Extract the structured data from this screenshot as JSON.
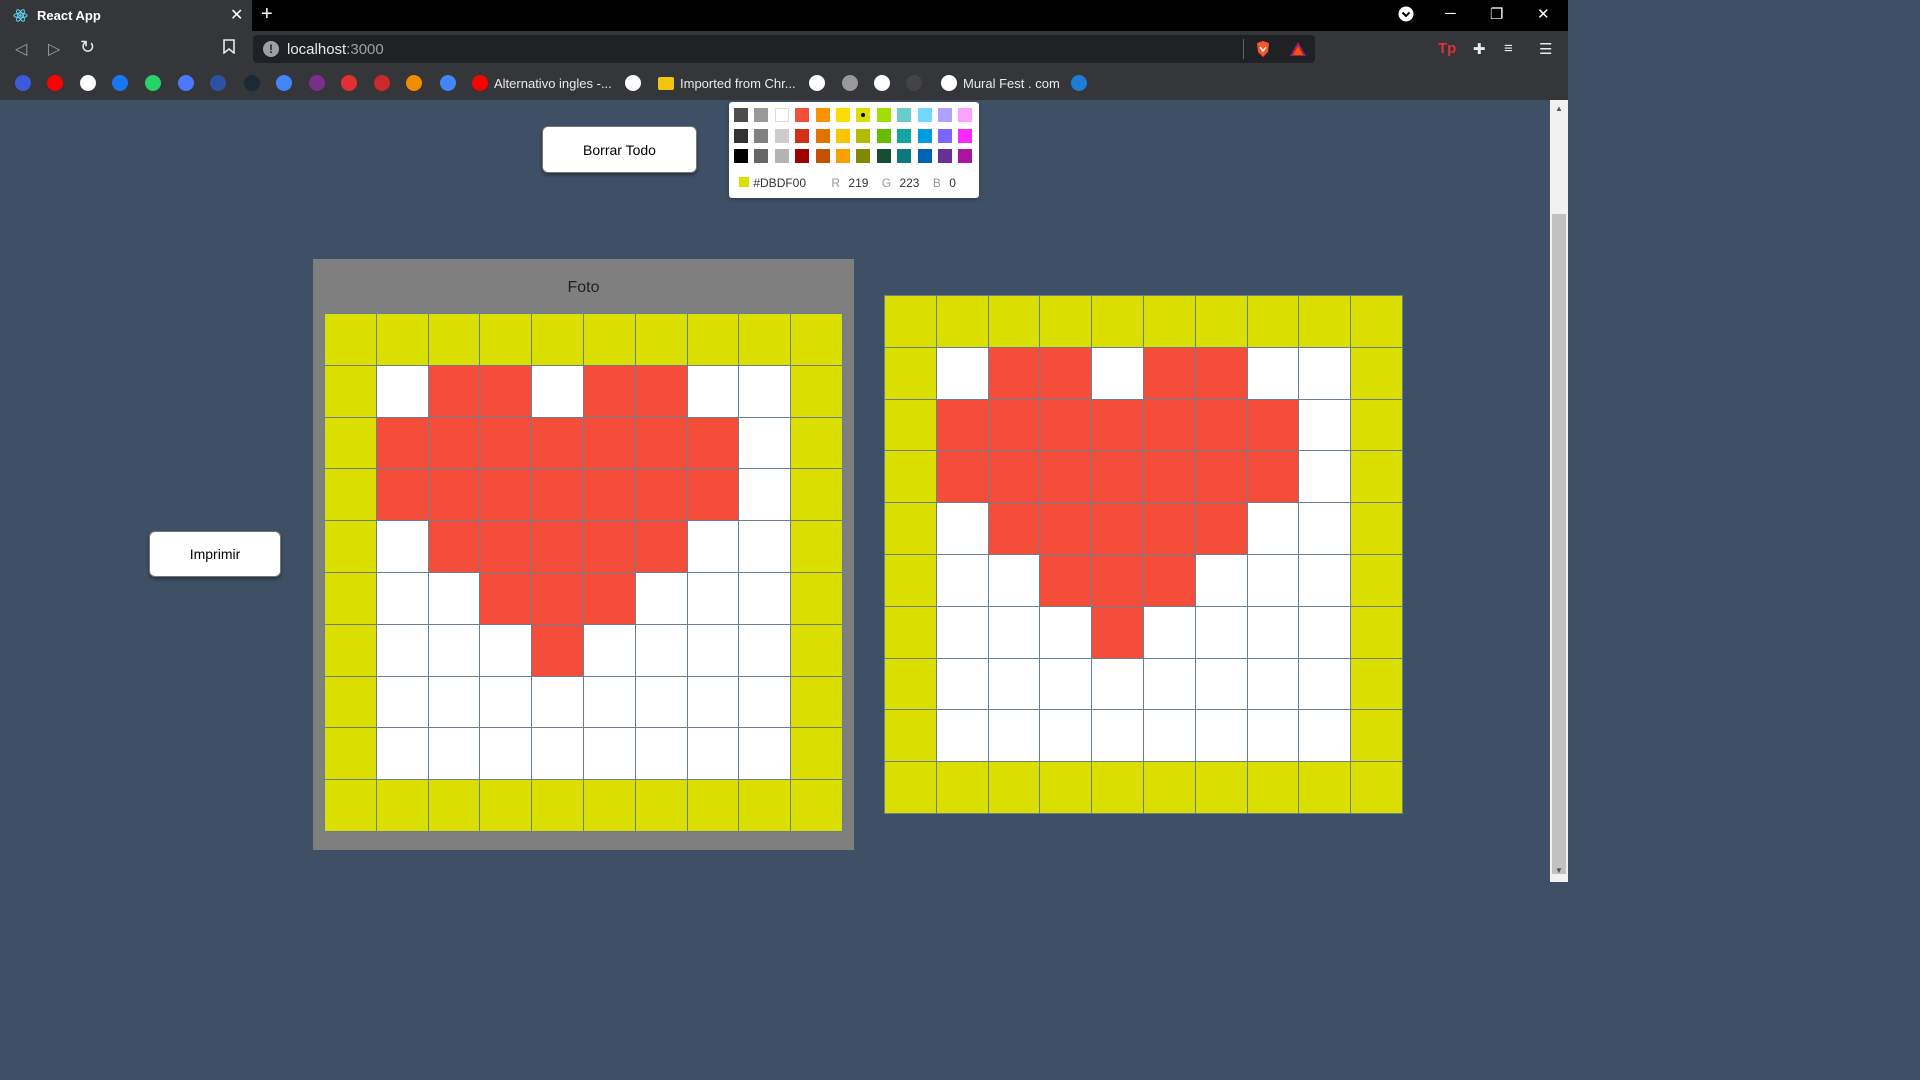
{
  "browser": {
    "tab_title": "React App",
    "tab_close": "✕",
    "new_tab": "+",
    "url_host": "localhost",
    "url_port": ":3000",
    "window_controls": [
      "─",
      "❐",
      "✕"
    ],
    "bookmarks": [
      {
        "label": "",
        "icon": "c-icon",
        "color": "#3b5bdb"
      },
      {
        "label": "",
        "icon": "youtube-icon",
        "color": "#ff0000"
      },
      {
        "label": "",
        "icon": "google-icon",
        "color": "#ffffff"
      },
      {
        "label": "",
        "icon": "facebook-icon",
        "color": "#1877f2"
      },
      {
        "label": "",
        "icon": "whatsapp-icon",
        "color": "#25d366"
      },
      {
        "label": "",
        "icon": "messenger-icon",
        "color": "#4a78ff"
      },
      {
        "label": "",
        "icon": "mal-icon",
        "color": "#2e51a2"
      },
      {
        "label": "",
        "icon": "tumblr-icon",
        "color": "#1b2836"
      },
      {
        "label": "",
        "icon": "translate-icon",
        "color": "#4285f4"
      },
      {
        "label": "",
        "icon": "game-icon",
        "color": "#7b2d8b"
      },
      {
        "label": "",
        "icon": "target-icon",
        "color": "#e03131"
      },
      {
        "label": "",
        "icon": "diamond-icon",
        "color": "#c92a2a"
      },
      {
        "label": "",
        "icon": "bars-icon",
        "color": "#f08c00"
      },
      {
        "label": "",
        "icon": "calendar-icon",
        "color": "#4285f4"
      },
      {
        "label": "Alternativo ingles -...",
        "icon": "youtube-icon",
        "color": "#ff0000"
      },
      {
        "label": "",
        "icon": "cat-icon",
        "color": "#ffffff"
      },
      {
        "label": "Imported from Chr...",
        "icon": "folder-icon",
        "color": "#f1c40f"
      },
      {
        "label": "",
        "icon": "qb-icon",
        "color": "#ffffff"
      },
      {
        "label": "",
        "icon": "art-icon",
        "color": "#999999"
      },
      {
        "label": "",
        "icon": "globe-icon",
        "color": "#ffffff"
      },
      {
        "label": "",
        "icon": "m-icon",
        "color": "#444444"
      },
      {
        "label": "Mural Fest . com",
        "icon": "mural-icon",
        "color": "#ffffff"
      },
      {
        "label": "",
        "icon": "bolt-icon",
        "color": "#1c7ed6"
      }
    ]
  },
  "page": {
    "clear_button": "Borrar Todo",
    "print_button": "Imprimir",
    "foto_title": "Foto"
  },
  "color_picker": {
    "swatches": [
      [
        "#4d4d4d",
        "#999999",
        "#ffffff",
        "#f44e3b",
        "#fe9200",
        "#fcdc00",
        "#dbdf00",
        "#a4dd00",
        "#68ccca",
        "#73d8ff",
        "#aea1ff",
        "#fda1ff"
      ],
      [
        "#333333",
        "#808080",
        "#cccccc",
        "#d33115",
        "#e27300",
        "#fcc400",
        "#b0bc00",
        "#68bc00",
        "#16a5a5",
        "#009ce0",
        "#7b64ff",
        "#fa28ff"
      ],
      [
        "#000000",
        "#666666",
        "#b3b3b3",
        "#9f0500",
        "#c45100",
        "#fb9e00",
        "#808900",
        "#194d33",
        "#0c797d",
        "#0062b1",
        "#653294",
        "#ab149e"
      ]
    ],
    "selected": "#dbdf00",
    "hex_value": "#DBDF00",
    "r_label": "R",
    "r_value": "219",
    "g_label": "G",
    "g_value": "223",
    "b_label": "B",
    "b_value": "0"
  },
  "colors": {
    "Y": "#dbdf00",
    "R": "#f44e3b",
    "W": "#ffffff"
  },
  "foto_grid": [
    "YYYYYYYYYY",
    "YWRRWRRWWY",
    "YRRRRRRRWY",
    "YRRRRRRRWY",
    "YWRRRRRWWY",
    "YWWRRRWWWY",
    "YWWWRWWWWY",
    "YWWWWWWWWY",
    "YWWWWWWWWY",
    "YYYYYYYYYY"
  ],
  "canvas_grid": [
    "YYYYYYYYYY",
    "YWRRWRRWWY",
    "YRRRRRRRWY",
    "YRRRRRRRWY",
    "YWRRRRRWWY",
    "YWWRRRWWWY",
    "YWWWRWWWWY",
    "YWWWWWWWWY",
    "YWWWWWWWWY",
    "YYYYYYYYYY"
  ]
}
